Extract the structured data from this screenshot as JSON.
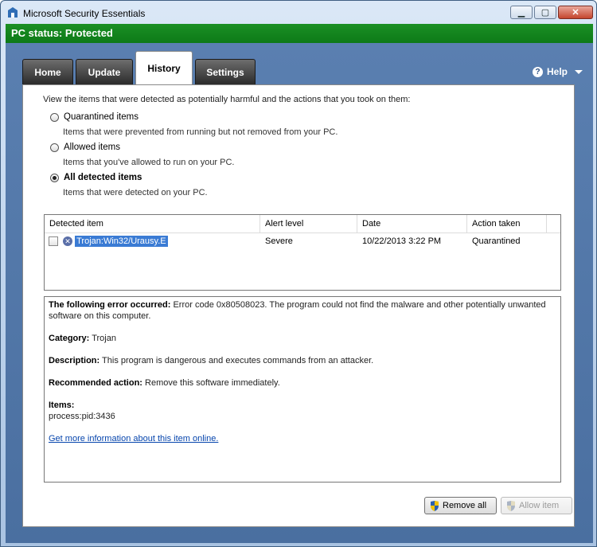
{
  "window": {
    "title": "Microsoft Security Essentials"
  },
  "status": {
    "text": "PC status: Protected",
    "color": "#1b8f25"
  },
  "tabs": [
    {
      "label": "Home"
    },
    {
      "label": "Update"
    },
    {
      "label": "History",
      "active": true
    },
    {
      "label": "Settings"
    }
  ],
  "help": {
    "label": "Help"
  },
  "history": {
    "intro": "View the items that were detected as potentially harmful and the actions that you took on them:",
    "options": [
      {
        "label": "Quarantined items",
        "description": "Items that were prevented from running but not removed from your PC.",
        "checked": false
      },
      {
        "label": "Allowed items",
        "description": "Items that you've allowed to run on your PC.",
        "checked": false
      },
      {
        "label": "All detected items",
        "description": "Items that were detected on your PC.",
        "checked": true
      }
    ],
    "table": {
      "columns": [
        "Detected item",
        "Alert level",
        "Date",
        "Action taken"
      ],
      "rows": [
        {
          "item": "Trojan:Win32/Urausy.E",
          "alert": "Severe",
          "date": "10/22/2013 3:22 PM",
          "action": "Quarantined"
        }
      ]
    },
    "details": {
      "error_label": "The following error occurred:",
      "error_text": "Error code 0x80508023. The program could not find the malware and other potentially unwanted software on this computer.",
      "category_label": "Category:",
      "category_value": "Trojan",
      "description_label": "Description:",
      "description_value": "This program is dangerous and executes commands from an attacker.",
      "action_label": "Recommended action:",
      "action_value": "Remove this software immediately.",
      "items_label": "Items:",
      "items_value": "process:pid:3436",
      "link": "Get more information about this item online."
    },
    "buttons": {
      "remove_all": "Remove all",
      "allow_item": "Allow item"
    }
  }
}
